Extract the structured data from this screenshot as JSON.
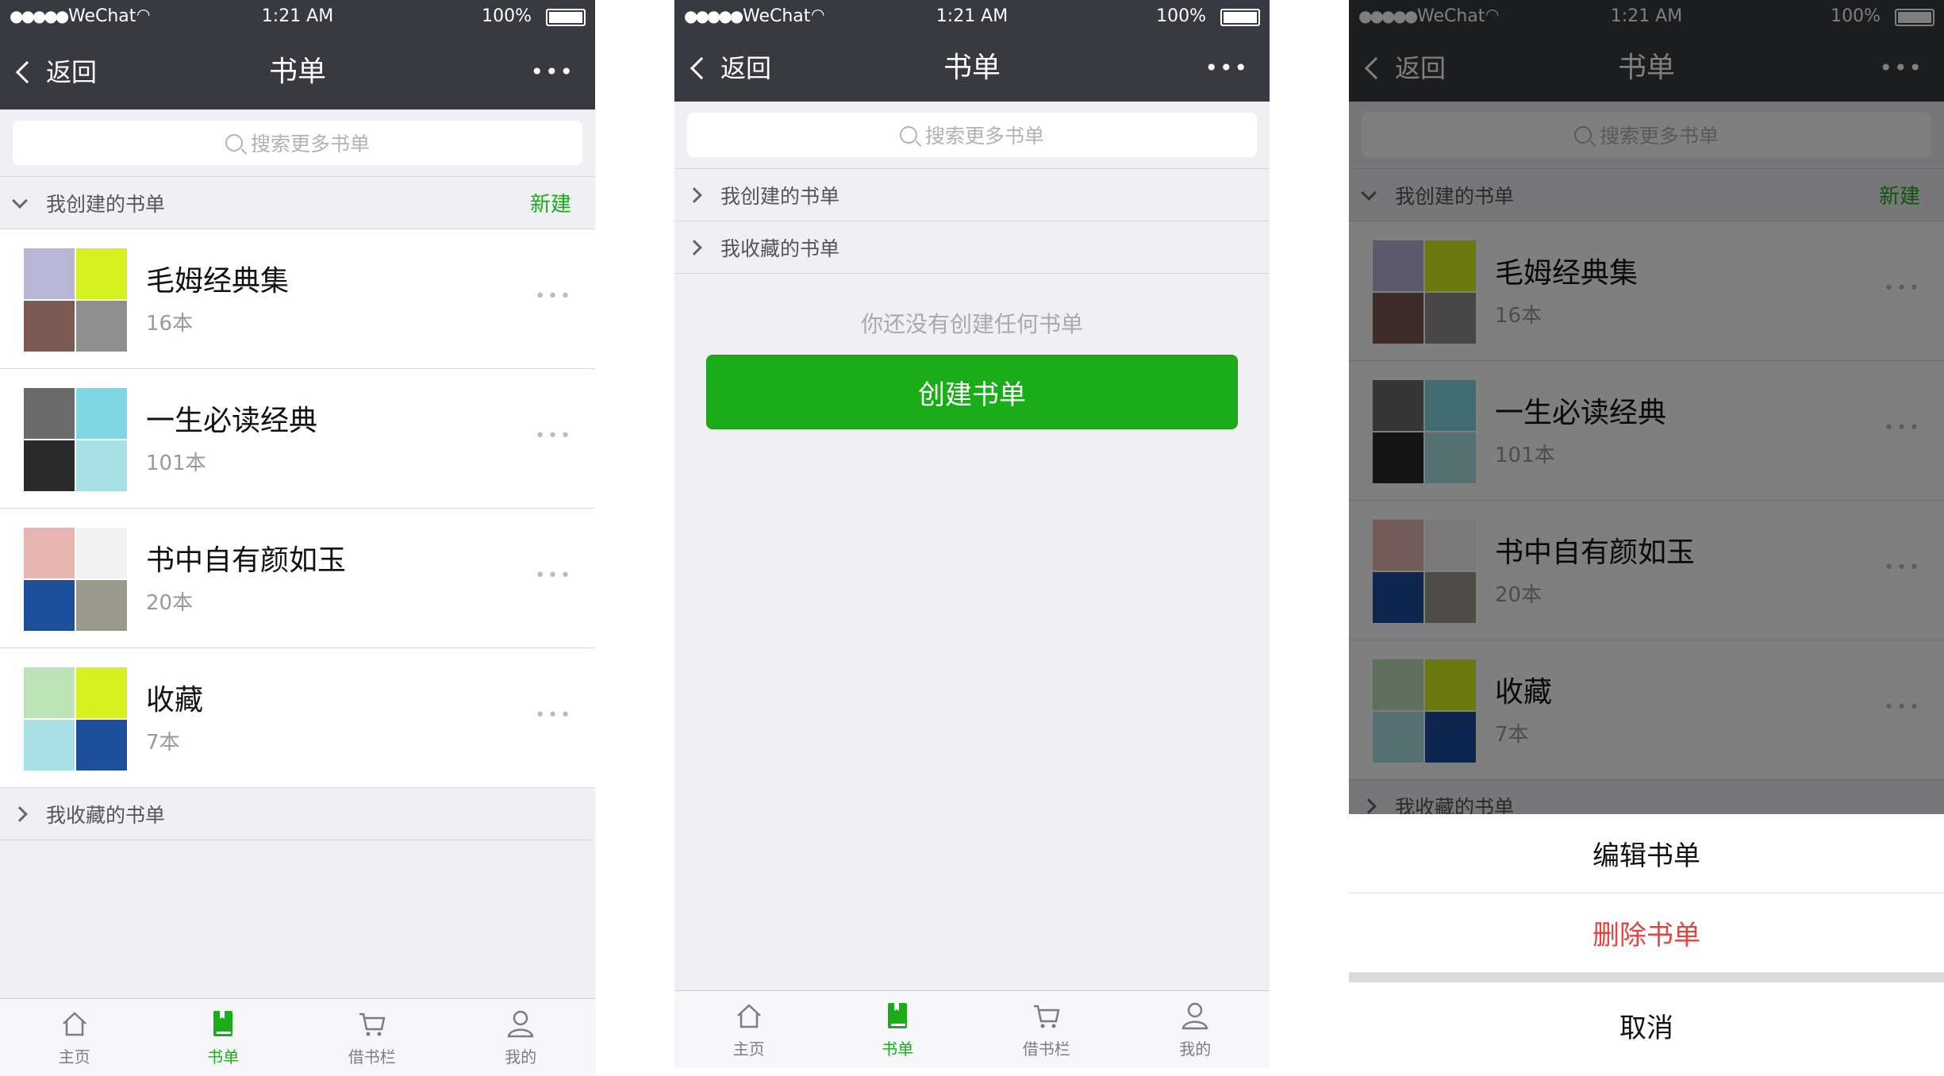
{
  "status": {
    "carrier": "WeChat",
    "time": "1:21 AM",
    "battery": "100%"
  },
  "nav": {
    "back": "返回",
    "title": "书单",
    "more": "•••"
  },
  "search": {
    "placeholder": "搜索更多书单"
  },
  "sections": {
    "created": "我创建的书单",
    "new": "新建",
    "collected": "我收藏的书单"
  },
  "lists": [
    {
      "name": "毛姆经典集",
      "count": "16本",
      "covers": [
        "#b8b5d6",
        "#d7f020",
        "#7a5a52",
        "#8e8e8e"
      ]
    },
    {
      "name": "一生必读经典",
      "count": "101本",
      "covers": [
        "#6b6b6b",
        "#7fd7e3",
        "#2a2a2a",
        "#a8e0e6"
      ]
    },
    {
      "name": "书中自有颜如玉",
      "count": "20本",
      "covers": [
        "#e8b6b0",
        "#f2f2f2",
        "#1e4f9c",
        "#9a9a8c"
      ]
    },
    {
      "name": "收藏",
      "count": "7本",
      "covers": [
        "#bfe3b8",
        "#d7f020",
        "#a8e0e6",
        "#1e4f9c"
      ]
    }
  ],
  "empty": {
    "text": "你还没有创建任何书单",
    "button": "创建书单"
  },
  "tabs": [
    {
      "label": "主页",
      "icon": "home-icon"
    },
    {
      "label": "书单",
      "icon": "book-icon"
    },
    {
      "label": "借书栏",
      "icon": "cart-icon"
    },
    {
      "label": "我的",
      "icon": "person-icon"
    }
  ],
  "sheet": {
    "edit": "编辑书单",
    "delete": "删除书单",
    "cancel": "取消"
  },
  "colors": {
    "accent": "#1aad19",
    "danger": "#e64340",
    "bar": "#393a3f"
  }
}
